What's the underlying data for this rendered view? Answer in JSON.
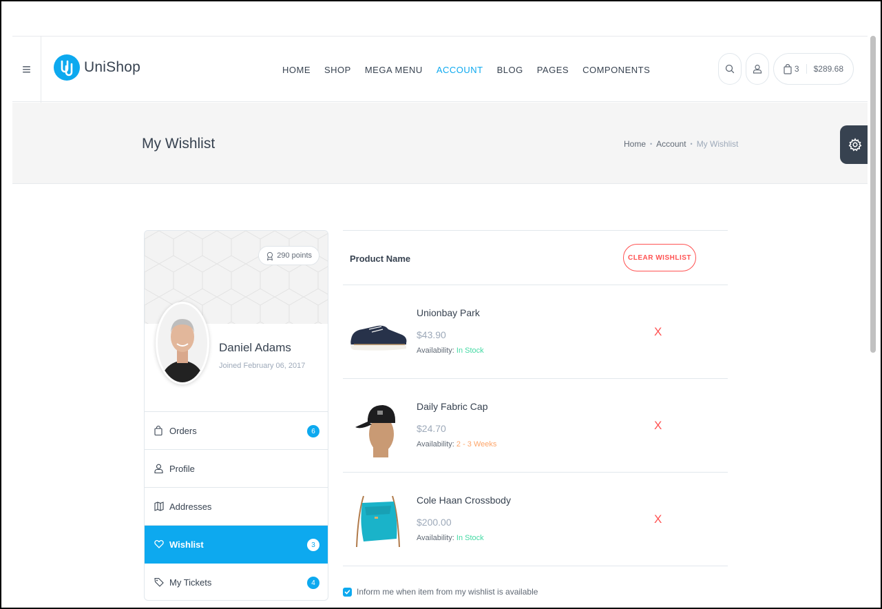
{
  "header": {
    "brand": "UniShop",
    "nav": [
      "HOME",
      "SHOP",
      "MEGA MENU",
      "ACCOUNT",
      "BLOG",
      "PAGES",
      "COMPONENTS"
    ],
    "active_nav": "ACCOUNT",
    "cart": {
      "count": "3",
      "total": "$289.68"
    }
  },
  "title_bar": {
    "title": "My Wishlist",
    "breadcrumb": [
      "Home",
      "Account",
      "My Wishlist"
    ]
  },
  "profile": {
    "points": "290 points",
    "name": "Daniel Adams",
    "joined": "Joined February 06, 2017",
    "menu": [
      {
        "label": "Orders",
        "icon": "bag-icon",
        "badge": "6",
        "active": false
      },
      {
        "label": "Profile",
        "icon": "user-icon",
        "badge": "",
        "active": false
      },
      {
        "label": "Addresses",
        "icon": "map-icon",
        "badge": "",
        "active": false
      },
      {
        "label": "Wishlist",
        "icon": "heart-icon",
        "badge": "3",
        "active": true
      },
      {
        "label": "My Tickets",
        "icon": "tag-icon",
        "badge": "4",
        "active": false
      }
    ]
  },
  "wishlist": {
    "column_header": "Product Name",
    "clear_label": "CLEAR WISHLIST",
    "availability_label": "Availability:",
    "items": [
      {
        "name": "Unionbay Park",
        "price": "$43.90",
        "availability": "In Stock",
        "status": "ok",
        "image": "sneaker"
      },
      {
        "name": "Daily Fabric Cap",
        "price": "$24.70",
        "availability": "2 - 3 Weeks",
        "status": "warn",
        "image": "cap"
      },
      {
        "name": "Cole Haan Crossbody",
        "price": "$200.00",
        "availability": "In Stock",
        "status": "ok",
        "image": "bag"
      }
    ],
    "remove_glyph": "X",
    "inform_label": "Inform me when item from my wishlist is available",
    "inform_checked": true
  },
  "colors": {
    "accent": "#0da9ef",
    "danger": "#ff5252",
    "success": "#43d9a3",
    "warning": "#fea569",
    "text": "#374250"
  }
}
